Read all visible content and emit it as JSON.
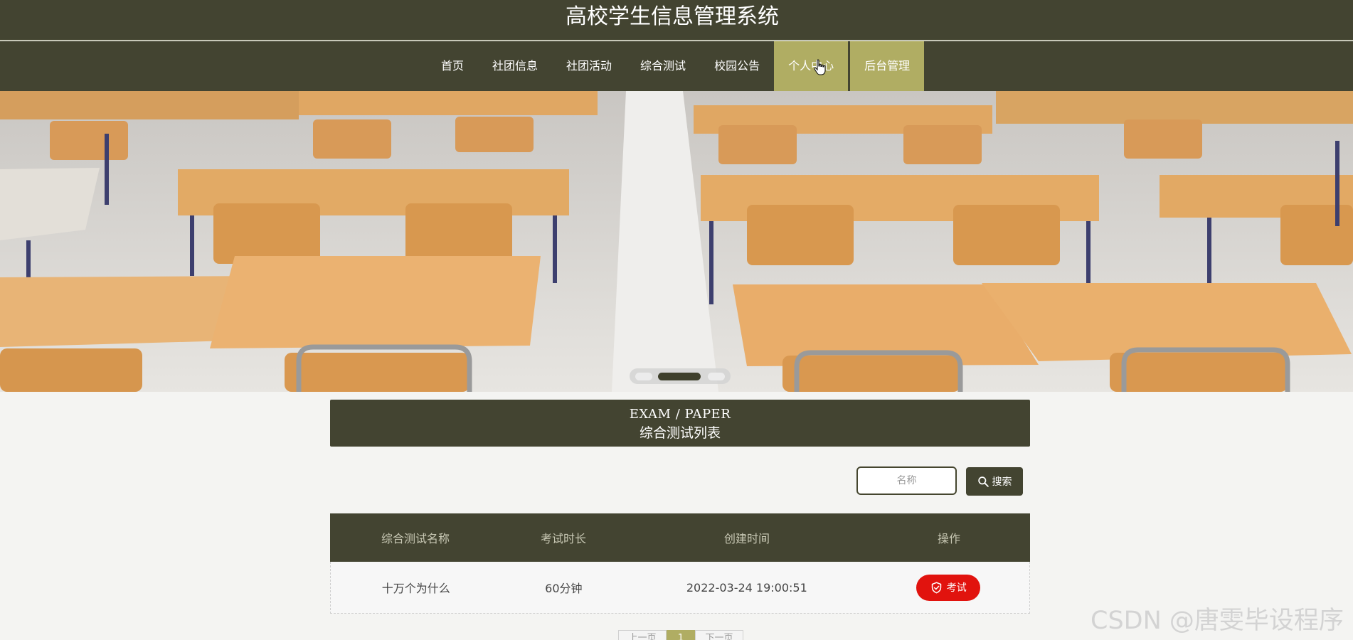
{
  "header": {
    "site_title": "高校学生信息管理系统"
  },
  "nav": {
    "items": [
      "首页",
      "社团信息",
      "社团活动",
      "综合测试",
      "校园公告",
      "个人中心",
      "后台管理"
    ],
    "active_items": [
      "个人中心",
      "后台管理"
    ]
  },
  "carousel": {
    "slide_count": 3,
    "active_index": 1
  },
  "section": {
    "title_en": "EXAM / PAPER",
    "title_cn": "综合测试列表"
  },
  "search": {
    "placeholder": "名称",
    "value": "",
    "button_label": "搜索"
  },
  "table": {
    "headers": [
      "综合测试名称",
      "考试时长",
      "创建时间",
      "操作"
    ],
    "rows": [
      {
        "name": "十万个为什么",
        "duration": "60分钟",
        "created": "2022-03-24 19:00:51",
        "action": "考试"
      }
    ]
  },
  "pagination": {
    "prev": "上一页",
    "current": "1",
    "next": "下一页"
  },
  "watermark": "CSDN @唐雯毕设程序",
  "colors": {
    "header_bg": "#434431",
    "accent": "#b0ad63",
    "exam_button": "#e1130e",
    "page_bg": "#f4f4f2"
  }
}
